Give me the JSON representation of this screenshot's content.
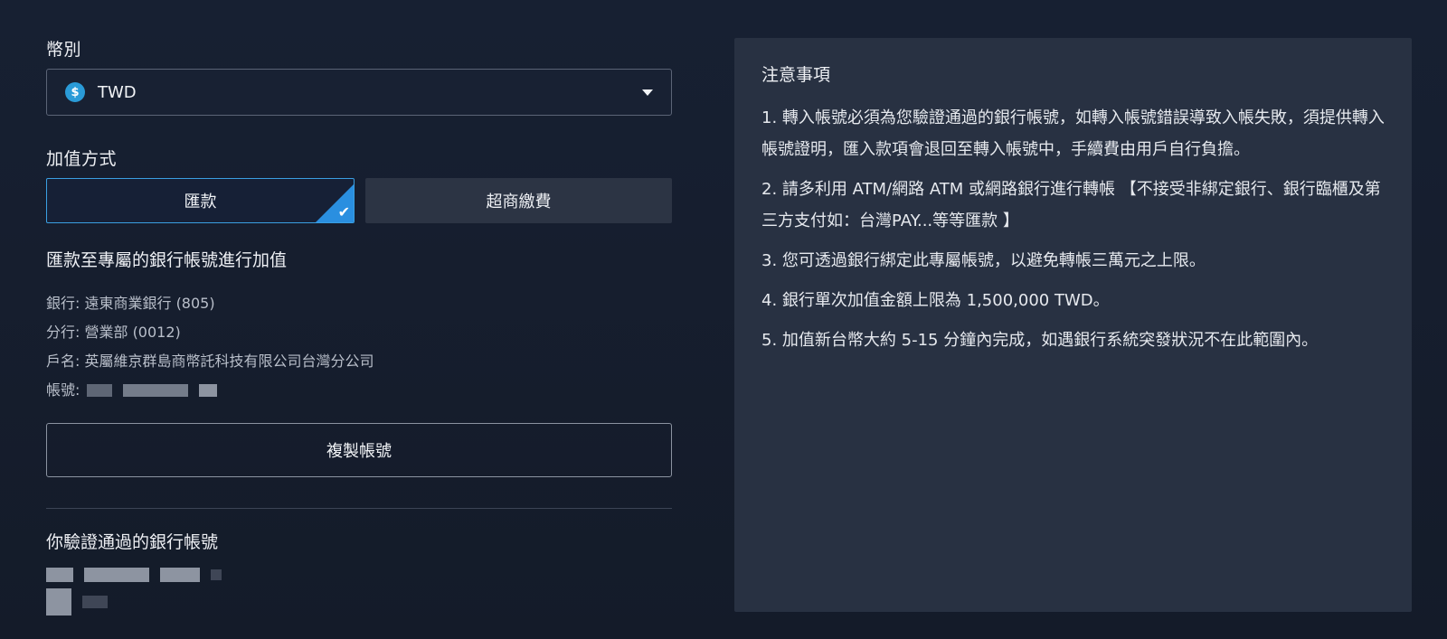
{
  "currency": {
    "label": "幣別",
    "icon": "dollar-coin-icon",
    "coin_symbol": "$",
    "value": "TWD"
  },
  "method": {
    "label": "加值方式",
    "tabs": [
      {
        "label": "匯款",
        "selected": true
      },
      {
        "label": "超商繳費",
        "selected": false
      }
    ]
  },
  "transfer": {
    "title": "匯款至專屬的銀行帳號進行加值",
    "bank": "銀行: 遠東商業銀行 (805)",
    "branch": "分行: 營業部 (0012)",
    "holder": "戶名: 英屬維京群島商幣託科技有限公司台灣分公司",
    "account_label": "帳號:",
    "copy_button": "複製帳號"
  },
  "verified": {
    "title": "你驗證通過的銀行帳號"
  },
  "notice": {
    "title": "注意事項",
    "items": [
      "1. 轉入帳號必須為您驗證通過的銀行帳號，如轉入帳號錯誤導致入帳失敗，須提供轉入帳號證明，匯入款項會退回至轉入帳號中，手續費由用戶自行負擔。",
      "2. 請多利用 ATM/網路 ATM 或網路銀行進行轉帳 【不接受非綁定銀行、銀行臨櫃及第三方支付如：台灣PAY...等等匯款 】",
      "3. 您可透過銀行綁定此專屬帳號，以避免轉帳三萬元之上限。",
      "4. 銀行單次加值金額上限為 1,500,000 TWD。",
      "5. 加值新台幣大約 5-15 分鐘內完成，如遇銀行系統突發狀況不在此範圍內。"
    ]
  },
  "colors": {
    "background": "#151c2b",
    "panel": "#283142",
    "accent": "#2a8fe0",
    "coin": "#2a9bd8"
  }
}
